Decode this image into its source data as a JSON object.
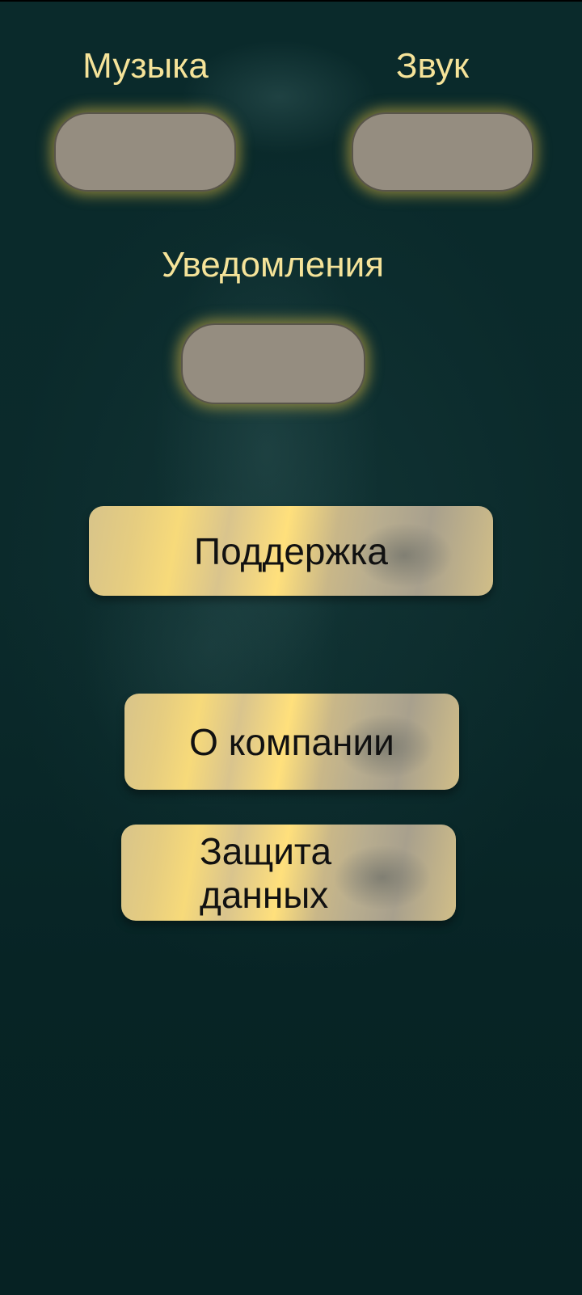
{
  "settings": {
    "music_label": "Музыка",
    "sound_label": "Звук",
    "notifications_label": "Уведомления"
  },
  "buttons": {
    "support": "Поддержка",
    "about": "О компании",
    "privacy": "Защита данных"
  },
  "colors": {
    "background": "#0a2a2b",
    "label_text": "#f5e399",
    "toggle_fill": "#958d80",
    "toggle_glow": "#e1be46",
    "button_gold": "#f7da7a",
    "button_text": "#111111"
  }
}
